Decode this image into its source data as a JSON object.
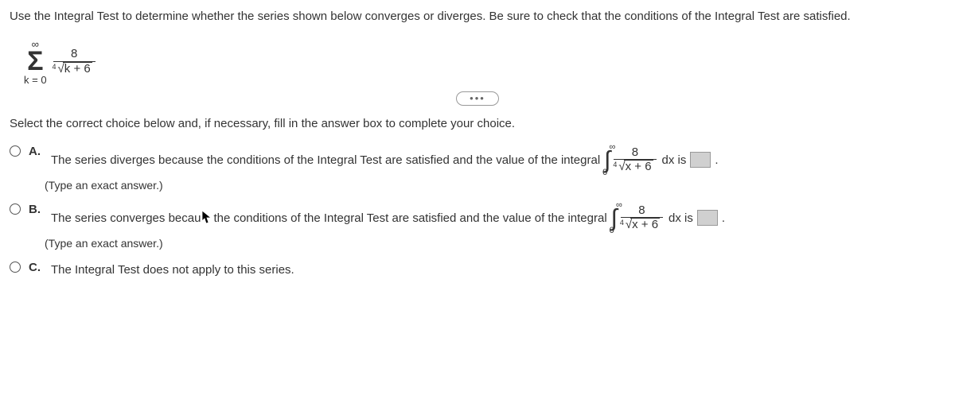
{
  "prompt": "Use the Integral Test to determine whether the series shown below converges or diverges. Be sure to check that the conditions of the Integral Test are satisfied.",
  "series": {
    "sigma_top": "∞",
    "sigma_bottom": "k = 0",
    "numerator": "8",
    "root_index": "4",
    "radicand": "k + 6"
  },
  "ellipsis": "•••",
  "instruction": "Select the correct choice below and, if necessary, fill in the answer box to complete your choice.",
  "choices": {
    "A": {
      "letter": "A.",
      "text_before": "The series diverges because the conditions of the Integral Test are satisfied and the value of the integral",
      "int_top": "∞",
      "int_bot": "0",
      "frac_num": "8",
      "root_idx": "4",
      "radicand": "x + 6",
      "dx_is": "dx is",
      "period": ".",
      "hint": "(Type an exact answer.)"
    },
    "B": {
      "letter": "B.",
      "text_before": "The series converges becau",
      "text_after": " the conditions of the Integral Test are satisfied and the value of the integral",
      "int_top": "∞",
      "int_bot": "0",
      "frac_num": "8",
      "root_idx": "4",
      "radicand": "x + 6",
      "dx_is": "dx is",
      "period": ".",
      "hint": "(Type an exact answer.)"
    },
    "C": {
      "letter": "C.",
      "text": "The Integral Test does not apply to this series."
    }
  }
}
